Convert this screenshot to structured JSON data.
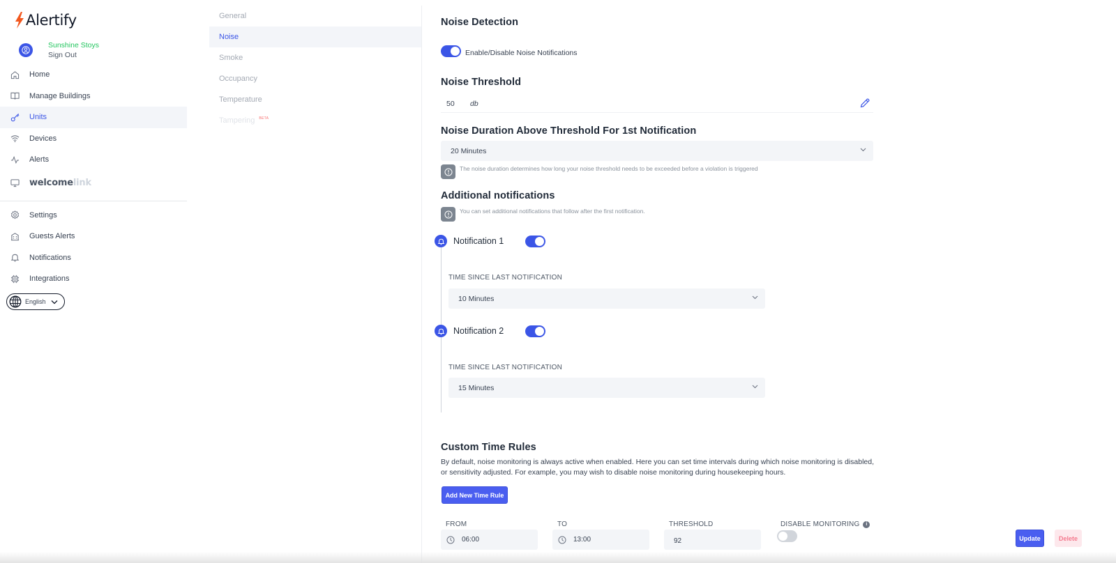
{
  "app": {
    "name": "Alertify",
    "brand_color": "#3b55e6"
  },
  "user": {
    "name": "Sunshine Stoys",
    "signout_label": "Sign Out"
  },
  "sidebar": {
    "items": [
      {
        "label": "Home",
        "icon": "home-icon"
      },
      {
        "label": "Manage Buildings",
        "icon": "book-icon"
      },
      {
        "label": "Units",
        "icon": "key-icon",
        "active": true
      },
      {
        "label": "Devices",
        "icon": "wifi-icon"
      },
      {
        "label": "Alerts",
        "icon": "activity-icon"
      }
    ],
    "brand_link": {
      "text_bold": "welcome",
      "text_light": "link",
      "icon": "monitor-icon"
    },
    "secondary_items": [
      {
        "label": "Settings",
        "icon": "gear-icon"
      },
      {
        "label": "Guests Alerts",
        "icon": "building-icon"
      },
      {
        "label": "Notifications",
        "icon": "bell-icon"
      },
      {
        "label": "Integrations",
        "icon": "chip-icon"
      }
    ],
    "language": "English"
  },
  "subnav": {
    "items": [
      {
        "label": "General"
      },
      {
        "label": "Noise",
        "active": true
      },
      {
        "label": "Smoke"
      },
      {
        "label": "Occupancy"
      },
      {
        "label": "Temperature"
      },
      {
        "label": "Tampering",
        "badge": "BETA",
        "disabled": true
      }
    ]
  },
  "noise": {
    "detection_title": "Noise Detection",
    "toggle_label": "Enable/Disable Noise Notifications",
    "toggle_on": true,
    "threshold_title": "Noise Threshold",
    "threshold_value": "50",
    "threshold_unit": "db",
    "duration_title": "Noise Duration Above Threshold For 1st Notification",
    "duration_value": "20 Minutes",
    "duration_info": "The noise duration determines how long your noise threshold needs to be exceeded before a violation is triggered",
    "additional_title": "Additional notifications",
    "additional_info": "You can set additional notifications that follow after the first notification.",
    "notifications": [
      {
        "label": "Notification 1",
        "enabled": true,
        "caption": "TIME SINCE LAST NOTIFICATION",
        "value": "10 Minutes"
      },
      {
        "label": "Notification 2",
        "enabled": true,
        "caption": "TIME SINCE LAST NOTIFICATION",
        "value": "15 Minutes"
      }
    ]
  },
  "custom_rules": {
    "title": "Custom Time Rules",
    "description": "By default, noise monitoring is always active when enabled. Here you can set time intervals during which noise monitoring is disabled, or sensitivity adjusted. For example, you may wish to disable noise monitoring during housekeeping hours.",
    "add_button": "Add New Time Rule",
    "columns": {
      "from": "FROM",
      "to": "TO",
      "threshold": "THRESHOLD",
      "disable": "DISABLE MONITORING"
    },
    "rule": {
      "from": "06:00",
      "to": "13:00",
      "threshold": "92",
      "disable_monitoring": false
    },
    "update_button": "Update",
    "delete_button": "Delete"
  }
}
